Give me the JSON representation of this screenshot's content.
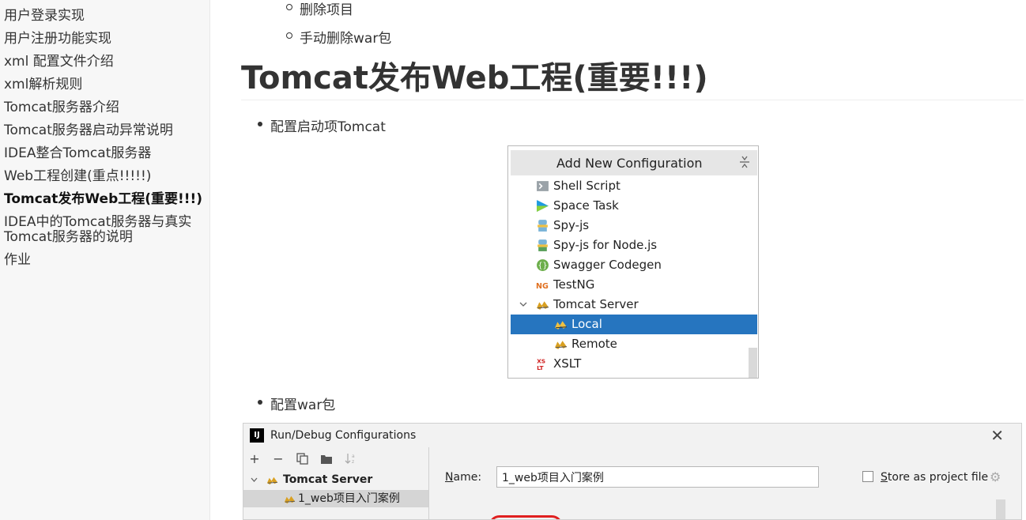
{
  "sidebar": {
    "items": [
      {
        "label": "用户登录实现"
      },
      {
        "label": "用户注册功能实现"
      },
      {
        "label": "xml 配置文件介绍"
      },
      {
        "label": "xml解析规则"
      },
      {
        "label": "Tomcat服务器介绍"
      },
      {
        "label": "Tomcat服务器启动异常说明"
      },
      {
        "label": "IDEA整合Tomcat服务器"
      },
      {
        "label": "Web工程创建(重点!!!!!)"
      },
      {
        "label": "Tomcat发布Web工程(重要!!!)",
        "active": true
      },
      {
        "label": "IDEA中的Tomcat服务器与真实Tomcat服务器的说明"
      },
      {
        "label": "作业"
      }
    ]
  },
  "content": {
    "sub_bullets": [
      "删除项目",
      "手动删除war包"
    ],
    "heading": "Tomcat发布Web工程(重要!!!)",
    "bullet1": "配置启动项Tomcat",
    "bullet2": "配置war包"
  },
  "add_config": {
    "title": "Add New Configuration",
    "items": [
      {
        "label": "Shell Script",
        "icon": "shell-script-icon"
      },
      {
        "label": "Space Task",
        "icon": "space-task-icon"
      },
      {
        "label": "Spy-js",
        "icon": "spy-js-icon"
      },
      {
        "label": "Spy-js for Node.js",
        "icon": "spy-js-node-icon"
      },
      {
        "label": "Swagger Codegen",
        "icon": "swagger-icon"
      },
      {
        "label": "TestNG",
        "icon": "testng-icon"
      },
      {
        "label": "Tomcat Server",
        "icon": "tomcat-icon",
        "expanded": true
      },
      {
        "label": "Local",
        "icon": "tomcat-icon",
        "selected": true
      },
      {
        "label": "Remote",
        "icon": "tomcat-icon"
      },
      {
        "label": "XSLT",
        "icon": "xslt-icon"
      }
    ],
    "colors": {
      "selected_bg": "#2675bf",
      "header_bg": "#e6e6e6"
    }
  },
  "run_debug": {
    "title": "Run/Debug Configurations",
    "logo_text": "IJ",
    "tree": {
      "group": "Tomcat Server",
      "item": "1_web项目入门案例"
    },
    "name_label_mnemonic": "N",
    "name_label_rest": "ame:",
    "name_value": "1_web项目入门案例",
    "store_label_mnemonic": "S",
    "store_label_rest": "tore as project file"
  }
}
